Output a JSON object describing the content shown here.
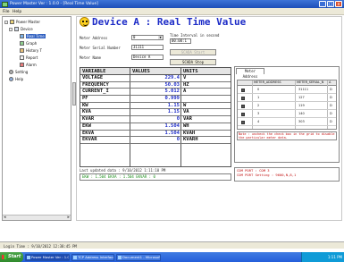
{
  "window": {
    "title": "Power Master Ver : 1.0.0 - [Real Time Value]",
    "minimize": "_",
    "maximize": "□",
    "close": "x"
  },
  "menu": {
    "file": "File",
    "help": "Help"
  },
  "tree": {
    "root": "Power Master",
    "device": "Device",
    "real_time": "Real Time",
    "graph": "Graph",
    "history": "History T",
    "report": "Report",
    "alarm": "Alarm",
    "setting": "Setting",
    "help": "Help"
  },
  "heading": "Device A : Real Time Value",
  "form": {
    "meter_address_label": "Meter Address",
    "meter_address_value": "0",
    "meter_serial_label": "Meter Serial Number",
    "meter_serial_value": "31111",
    "meter_name_label": "Meter Name",
    "meter_name_value": "Device A",
    "time_interval_label": "Time Interval in second",
    "time_interval_value": "00:00:1",
    "start_button": "SCADA Start",
    "stop_button": "SCADA Stop"
  },
  "table": {
    "headers": [
      "VARIABLE",
      "VALUES",
      "UNITS"
    ],
    "rows": [
      {
        "name": "VOLTAGE",
        "value": "229.4",
        "unit": "V"
      },
      {
        "name": "FREQUENCY",
        "value": "50.03",
        "unit": "HZ"
      },
      {
        "name": "CURRENT_I",
        "value": "5.012",
        "unit": "A"
      },
      {
        "name": "PF",
        "value": "0.999",
        "unit": ""
      },
      {
        "name": "KW",
        "value": "1.15",
        "unit": "W"
      },
      {
        "name": "KVA",
        "value": "1.15",
        "unit": "VA"
      },
      {
        "name": "KVAR",
        "value": "0",
        "unit": "VAR"
      },
      {
        "name": "EKW",
        "value": "1.504",
        "unit": "WH"
      },
      {
        "name": "EKVA",
        "value": "1.504",
        "unit": "KVAH"
      },
      {
        "name": "EKVAR",
        "value": "0",
        "unit": "KVARH"
      }
    ]
  },
  "last_updated": "Last updated data : 9/10/2012 1:11:10 PM",
  "status_line": "EKW : 1.504   EKVA : 1.504   EKVAR : 0",
  "meter_panel": {
    "tab": "Meter Address",
    "columns": [
      "METER_ADDRESS",
      "METER_SERIAL_N",
      "A"
    ],
    "rows": [
      {
        "addr": "0",
        "serial": "31111",
        "x": "D"
      },
      {
        "addr": "1",
        "serial": "127",
        "x": "D"
      },
      {
        "addr": "2",
        "serial": "119",
        "x": "D"
      },
      {
        "addr": "3",
        "serial": "140",
        "x": "D"
      },
      {
        "addr": "4",
        "serial": "303",
        "x": "D"
      }
    ],
    "note": "Note : uncheck the check box in the grid to disable the particular meter data.",
    "com_port": "COM PORT : COM 3",
    "com_setting": "COM PORT Setting : 9600,N,8,1"
  },
  "statusbar": "Login Time : 9/10/2012 12:38:45 PM",
  "taskbar": {
    "start": "Start",
    "items": [
      "Power Master Ver : 1.0...",
      "TCP Address Interface",
      "Document1 - Microsoft ..."
    ],
    "clock": "1:11 PM"
  }
}
